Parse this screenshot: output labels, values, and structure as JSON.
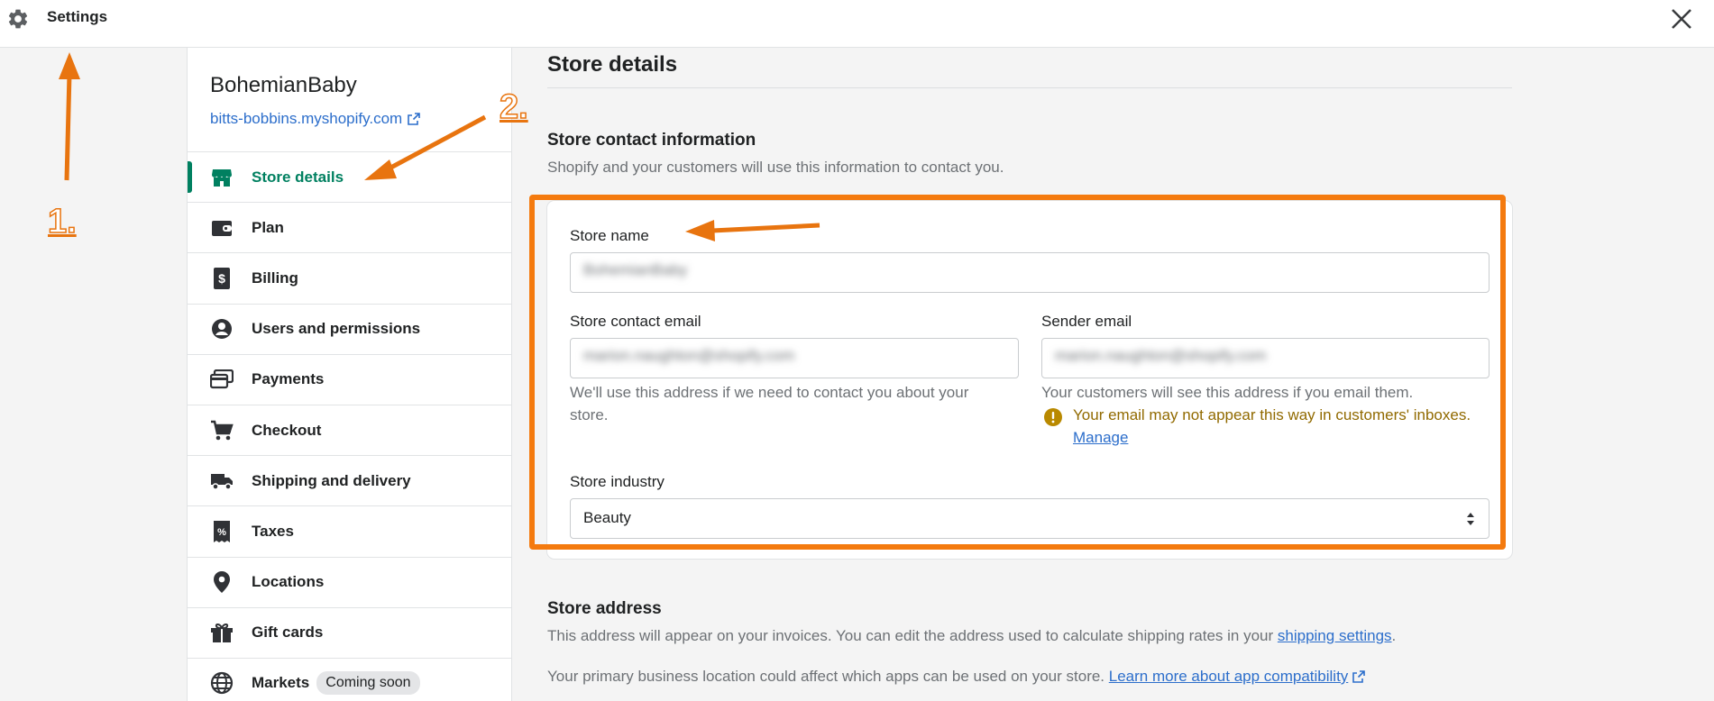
{
  "topbar": {
    "title": "Settings",
    "icon": "gear-icon",
    "close_icon": "close-icon"
  },
  "store": {
    "name": "BohemianBaby",
    "url": "bitts-bobbins.myshopify.com"
  },
  "nav": [
    {
      "label": "Store details",
      "icon": "store-icon",
      "active": true
    },
    {
      "label": "Plan",
      "icon": "wallet-icon"
    },
    {
      "label": "Billing",
      "icon": "billing-icon"
    },
    {
      "label": "Users and permissions",
      "icon": "user-icon"
    },
    {
      "label": "Payments",
      "icon": "payments-icon"
    },
    {
      "label": "Checkout",
      "icon": "cart-icon"
    },
    {
      "label": "Shipping and delivery",
      "icon": "truck-icon"
    },
    {
      "label": "Taxes",
      "icon": "taxes-icon"
    },
    {
      "label": "Locations",
      "icon": "location-pin-icon"
    },
    {
      "label": "Gift cards",
      "icon": "gift-icon"
    },
    {
      "label": "Markets",
      "icon": "globe-icon",
      "badge": "Coming soon"
    }
  ],
  "main": {
    "page_title": "Store details",
    "contact": {
      "title": "Store contact information",
      "subtitle": "Shopify and your customers will use this information to contact you.",
      "store_name_label": "Store name",
      "store_name_value": "BohemianBaby",
      "contact_email_label": "Store contact email",
      "contact_email_value": "marion.naughton@shopify.com",
      "contact_email_help_1": "We'll use this address if we need to contact you about your",
      "contact_email_help_2": "store.",
      "sender_email_label": "Sender email",
      "sender_email_value": "marion.naughton@shopify.com",
      "sender_email_help": "Your customers will see this address if you email them.",
      "warning": "Your email may not appear this way in customers' inboxes.",
      "manage_link": "Manage",
      "industry_label": "Store industry",
      "industry_value": "Beauty"
    },
    "address": {
      "title": "Store address",
      "line1": "This address will appear on your invoices. You can edit the address used to calculate shipping rates in your",
      "line1_link": "shipping settings",
      "line1_end": ".",
      "line2": "Your primary business location could affect which apps can be used on your store.",
      "line2_link": "Learn more about app compatibility"
    }
  },
  "annotations": {
    "step1": "1.",
    "step2": "2.",
    "color": "#e8740f",
    "highlight_color": "#f47a0e"
  },
  "colors": {
    "accent": "#008060",
    "link": "#2c6ecb",
    "warning": "#916a00"
  }
}
